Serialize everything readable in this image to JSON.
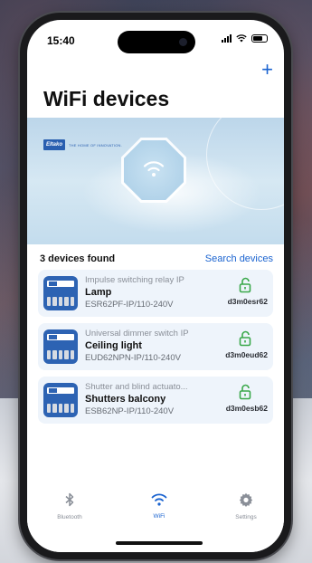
{
  "status": {
    "time": "15:40"
  },
  "header": {
    "title": "WiFi devices",
    "add_label": "+"
  },
  "banner": {
    "brand": "Eltako",
    "tagline": "THE HOME OF INNOVATION."
  },
  "list_header": {
    "count_text": "3 devices found",
    "search_label": "Search devices"
  },
  "devices": [
    {
      "type": "Impulse switching relay IP",
      "name": "Lamp",
      "model": "ESR62PF-IP/110-240V",
      "id": "d3m0esr62"
    },
    {
      "type": "Universal dimmer switch IP",
      "name": "Ceiling light",
      "model": "EUD62NPN-IP/110-240V",
      "id": "d3m0eud62"
    },
    {
      "type": "Shutter and blind actuato...",
      "name": "Shutters balcony",
      "model": "ESB62NP-IP/110-240V",
      "id": "d3m0esb62"
    }
  ],
  "tabs": [
    {
      "label": "Bluetooth",
      "icon": "bluetooth-icon",
      "active": false
    },
    {
      "label": "WiFi",
      "icon": "wifi-icon",
      "active": true
    },
    {
      "label": "Settings",
      "icon": "gear-icon",
      "active": false
    }
  ],
  "colors": {
    "accent": "#1a63d0",
    "card_bg": "#eef4fb",
    "lock_green": "#3aa84a",
    "device_blue": "#2d63b3"
  }
}
